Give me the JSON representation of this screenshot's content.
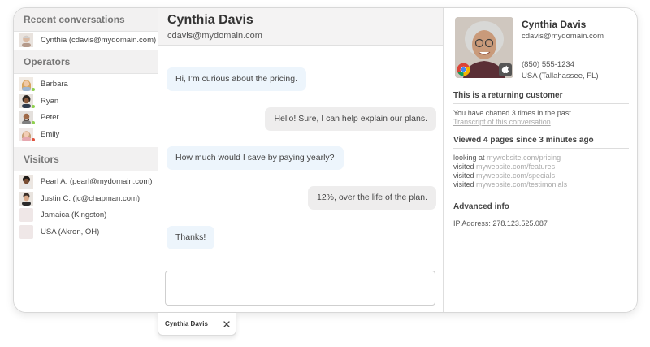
{
  "left": {
    "recent_heading": "Recent conversations",
    "recent": [
      {
        "label": "Cynthia (cdavis@mydomain.com)"
      }
    ],
    "operators_heading": "Operators",
    "operators": [
      {
        "label": "Barbara",
        "status": "#8fd14f"
      },
      {
        "label": "Ryan",
        "status": "#8fd14f"
      },
      {
        "label": "Peter",
        "status": "#8fd14f"
      },
      {
        "label": "Emily",
        "status": "#e0533e"
      }
    ],
    "visitors_heading": "Visitors",
    "visitors": [
      {
        "label": "Pearl A. (pearl@mydomain.com)"
      },
      {
        "label": "Justin C. (jc@chapman.com)"
      },
      {
        "label": "Jamaica (Kingston)"
      },
      {
        "label": "USA (Akron, OH)"
      }
    ]
  },
  "chat": {
    "name": "Cynthia Davis",
    "email": "cdavis@mydomain.com",
    "messages": [
      {
        "from": "visitor",
        "text": "Hi, I’m curious about the pricing."
      },
      {
        "from": "operator",
        "text": "Hello! Sure, I can help explain our plans."
      },
      {
        "from": "visitor",
        "text": "How much would I save by paying yearly?"
      },
      {
        "from": "operator",
        "text": "12%, over the life of the plan."
      },
      {
        "from": "visitor",
        "text": "Thanks!"
      }
    ],
    "composer_value": ""
  },
  "profile": {
    "name": "Cynthia Davis",
    "email": "cdavis@mydomain.com",
    "phone": "(850) 555-1234",
    "location": "USA (Tallahassee, FL)",
    "browser_icon": "chrome-icon",
    "os_icon": "apple-icon",
    "returning_heading": "This is a returning customer",
    "returning_text": "You have chatted 3 times in the past.",
    "transcript_link": "Transcript of this conversation",
    "viewed_heading": "Viewed 4 pages since 3 minutes ago",
    "pages": [
      {
        "action": "looking at",
        "url": "mywebsite.com/pricing"
      },
      {
        "action": "visited",
        "url": "mywebsite.com/features"
      },
      {
        "action": "visited",
        "url": "mywebsite.com/specials"
      },
      {
        "action": "visited",
        "url": "mywebsite.com/testimonials"
      }
    ],
    "advanced_heading": "Advanced info",
    "ip_text": "IP Address: 278.123.525.087"
  },
  "tab": {
    "name": "Cynthia Davis",
    "close_icon": "close-icon"
  },
  "colors": {
    "visitor_bubble": "#edf5fc",
    "operator_bubble": "#eeeded",
    "online": "#8fd14f",
    "away": "#e0533e"
  }
}
